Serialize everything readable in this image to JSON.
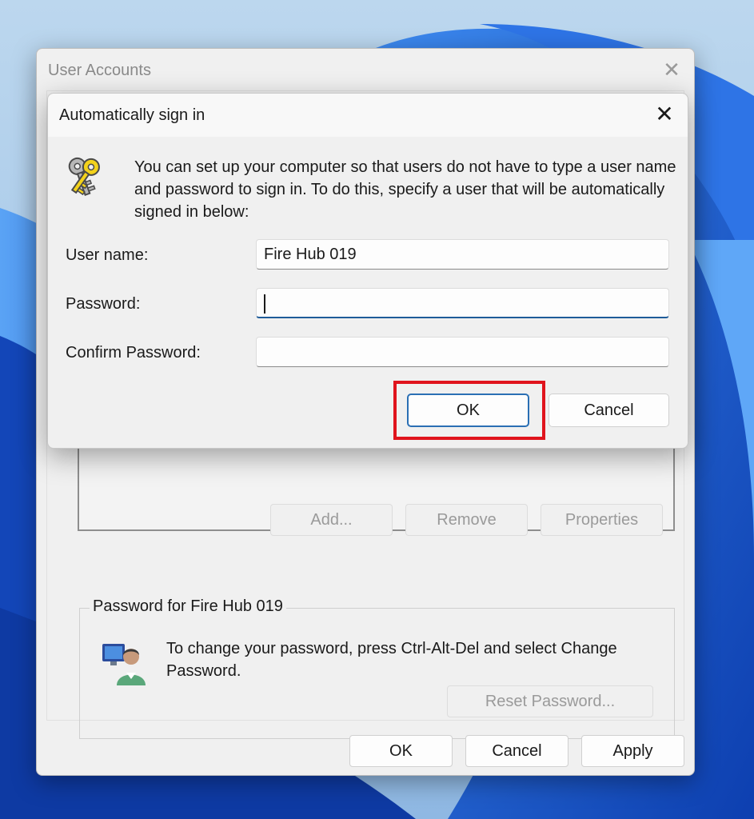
{
  "parent_window": {
    "title": "User Accounts",
    "buttons": {
      "add": "Add...",
      "remove": "Remove",
      "properties": "Properties",
      "reset_password": "Reset Password...",
      "ok": "OK",
      "cancel": "Cancel",
      "apply": "Apply"
    },
    "password_group": {
      "legend": "Password for Fire Hub 019",
      "text": "To change your password, press Ctrl-Alt-Del and select Change Password."
    }
  },
  "dialog": {
    "title": "Automatically sign in",
    "message": "You can set up your computer so that users do not have to type a user name and password to sign in. To do this, specify a user that will be automatically signed in below:",
    "fields": {
      "user_name_label": "User name:",
      "user_name_value": "Fire Hub 019",
      "password_label": "Password:",
      "password_value": "",
      "confirm_label": "Confirm Password:",
      "confirm_value": ""
    },
    "buttons": {
      "ok": "OK",
      "cancel": "Cancel"
    }
  },
  "colors": {
    "highlight": "#e0141d",
    "focus_accent": "#1f5c99",
    "wallpaper_blue": "#1d5fd6"
  }
}
